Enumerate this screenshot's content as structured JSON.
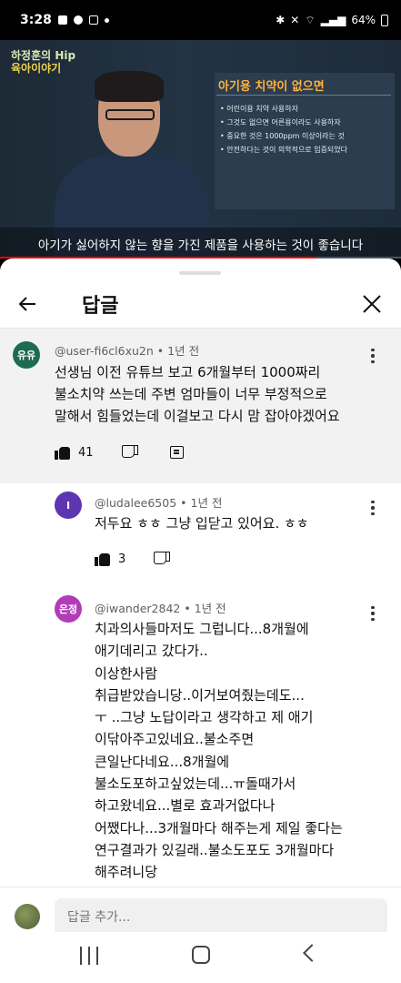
{
  "status_bar": {
    "time": "3:28",
    "battery": "64%"
  },
  "video": {
    "logo_line1": "하정훈의 Hip",
    "logo_line2": "육아이야기",
    "slide_title": "아기용 치약이 없으면",
    "slide_bullets": [
      "• 어린이용 치약 사용하자",
      "• 그것도 없으면 어른용이라도 사용하자",
      "• 중요한 것은 1000ppm 이상이라는 것",
      "• 안전하다는 것이 의학적으로 입증되었다"
    ],
    "subtitle": "아기가 싫어하지 않는 향을 가진 제품을 사용하는 것이 좋습니다",
    "progress": 0.79,
    "progress_color": "#ff0000"
  },
  "sheet": {
    "title": "답글",
    "back_icon": "arrow-left-icon",
    "close_icon": "close-icon"
  },
  "parent_comment": {
    "avatar_text": "유유",
    "avatar_color": "#1e6b52",
    "author": "@user-fi6cl6xu2n",
    "time": "1년 전",
    "lines": [
      "선생님 이전 유튜브 보고 6개월부터 1000짜리",
      "불소치약 쓰는데 주변 엄마들이 너무 부정적으로",
      "말해서 힘들었는데 이걸보고 다시 맘 잡아야겠어요"
    ],
    "likes": "41"
  },
  "replies": [
    {
      "avatar_text": "I",
      "avatar_color": "#5e35b1",
      "author": "@ludalee6505",
      "time": "1년 전",
      "lines": [
        "저두요 ㅎㅎ 그냥 입닫고 있어요. ㅎㅎ"
      ],
      "likes": "3"
    },
    {
      "avatar_text": "은정",
      "avatar_color": "#b23cb8",
      "author": "@iwander2842",
      "time": "1년 전",
      "lines": [
        "치과의사들마저도 그럽니다...8개월에",
        "애기데리고 갔다가..",
        "이상한사람",
        "취급받았습니당..이거보여줬는데도...",
        "ㅜ ..그냥 노답이라고 생각하고 제 애기",
        "이닦아주고있네요..불소주면",
        "큰일난다네요...8개월에",
        "불소도포하고싶었는데...ㅠ돌때가서",
        "하고왔네요...별로 효과거없다나",
        "어쨌다나...3개월마다 해주는게 제일 좋다는",
        "연구결과가 있길래..불소도포도 3개월마다",
        "해주려니당"
      ]
    }
  ],
  "input": {
    "placeholder": "답글 추가..."
  }
}
